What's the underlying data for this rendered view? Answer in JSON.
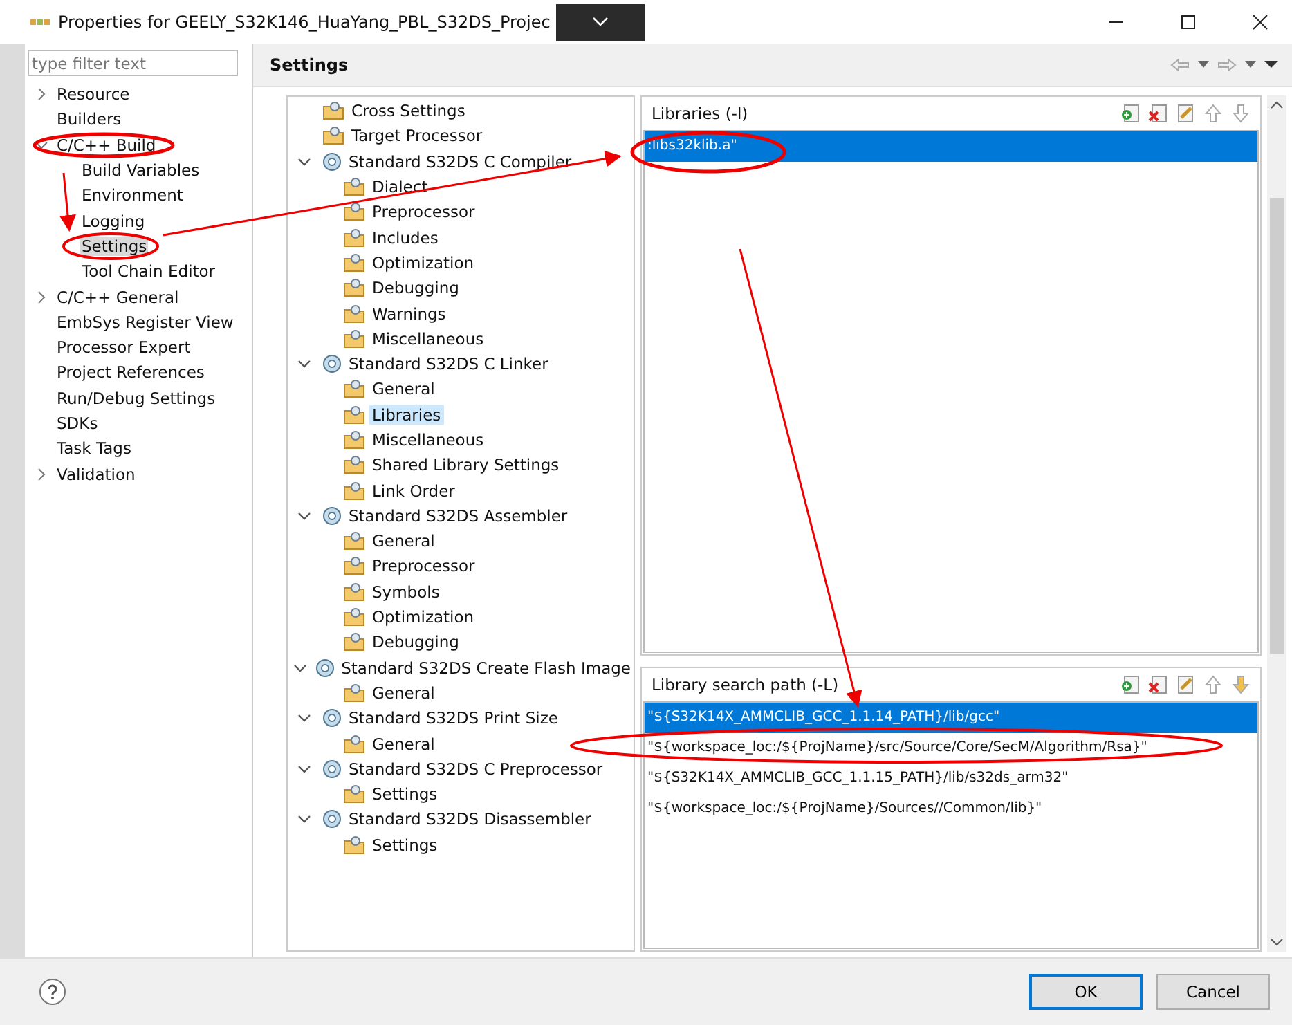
{
  "window": {
    "title": "Properties for GEELY_S32K146_HuaYang_PBL_S32DS_Projec"
  },
  "filter": {
    "placeholder": "type filter text"
  },
  "nav": [
    {
      "label": "Resource",
      "expanded": false,
      "selected": false
    },
    {
      "label": "Builders",
      "selected": false
    },
    {
      "label": "C/C++ Build",
      "expanded": true,
      "selected": false,
      "children": [
        {
          "label": "Build Variables",
          "selected": false
        },
        {
          "label": "Environment",
          "selected": false
        },
        {
          "label": "Logging",
          "selected": false
        },
        {
          "label": "Settings",
          "selected": true
        },
        {
          "label": "Tool Chain Editor",
          "selected": false
        }
      ]
    },
    {
      "label": "C/C++ General",
      "expanded": false,
      "selected": false
    },
    {
      "label": "EmbSys Register View",
      "selected": false
    },
    {
      "label": "Processor Expert",
      "selected": false
    },
    {
      "label": "Project References",
      "selected": false
    },
    {
      "label": "Run/Debug Settings",
      "selected": false
    },
    {
      "label": "SDKs",
      "selected": false
    },
    {
      "label": "Task Tags",
      "selected": false
    },
    {
      "label": "Validation",
      "expanded": false,
      "selected": false
    }
  ],
  "page_title": "Settings",
  "tools": [
    {
      "label": "Cross Settings",
      "kind": "option",
      "selected": false
    },
    {
      "label": "Target Processor",
      "kind": "option",
      "selected": false
    },
    {
      "label": "Standard S32DS C Compiler",
      "kind": "tool",
      "expanded": true,
      "selected": false,
      "children": [
        {
          "label": "Dialect",
          "kind": "option",
          "selected": false
        },
        {
          "label": "Preprocessor",
          "kind": "option",
          "selected": false
        },
        {
          "label": "Includes",
          "kind": "option",
          "selected": false
        },
        {
          "label": "Optimization",
          "kind": "option",
          "selected": false
        },
        {
          "label": "Debugging",
          "kind": "option",
          "selected": false
        },
        {
          "label": "Warnings",
          "kind": "option",
          "selected": false
        },
        {
          "label": "Miscellaneous",
          "kind": "option",
          "selected": false
        }
      ]
    },
    {
      "label": "Standard S32DS C Linker",
      "kind": "tool",
      "expanded": true,
      "selected": false,
      "children": [
        {
          "label": "General",
          "kind": "option",
          "selected": false
        },
        {
          "label": "Libraries",
          "kind": "option",
          "selected": true
        },
        {
          "label": "Miscellaneous",
          "kind": "option",
          "selected": false
        },
        {
          "label": "Shared Library Settings",
          "kind": "option",
          "selected": false
        },
        {
          "label": "Link Order",
          "kind": "option",
          "selected": false
        }
      ]
    },
    {
      "label": "Standard S32DS Assembler",
      "kind": "tool",
      "expanded": true,
      "selected": false,
      "children": [
        {
          "label": "General",
          "kind": "option",
          "selected": false
        },
        {
          "label": "Preprocessor",
          "kind": "option",
          "selected": false
        },
        {
          "label": "Symbols",
          "kind": "option",
          "selected": false
        },
        {
          "label": "Optimization",
          "kind": "option",
          "selected": false
        },
        {
          "label": "Debugging",
          "kind": "option",
          "selected": false
        }
      ]
    },
    {
      "label": "Standard S32DS Create Flash Image",
      "kind": "tool",
      "expanded": true,
      "selected": false,
      "children": [
        {
          "label": "General",
          "kind": "option",
          "selected": false
        }
      ]
    },
    {
      "label": "Standard S32DS Print Size",
      "kind": "tool",
      "expanded": true,
      "selected": false,
      "children": [
        {
          "label": "General",
          "kind": "option",
          "selected": false
        }
      ]
    },
    {
      "label": "Standard S32DS C Preprocessor",
      "kind": "tool",
      "expanded": true,
      "selected": false,
      "children": [
        {
          "label": "Settings",
          "kind": "option",
          "selected": false
        }
      ]
    },
    {
      "label": "Standard S32DS Disassembler",
      "kind": "tool",
      "expanded": true,
      "selected": false,
      "children": [
        {
          "label": "Settings",
          "kind": "option",
          "selected": false
        }
      ]
    }
  ],
  "lists": [
    {
      "title": "Libraries (-l)",
      "items": [
        {
          "text": ":libs32klib.a\"",
          "selected": true
        }
      ]
    },
    {
      "title": "Library search path (-L)",
      "items": [
        {
          "text": "\"${S32K14X_AMMCLIB_GCC_1.1.14_PATH}/lib/gcc\"",
          "selected": true
        },
        {
          "text": "\"${workspace_loc:/${ProjName}/src/Source/Core/SecM/Algorithm/Rsa}\"",
          "selected": false
        },
        {
          "text": "\"${S32K14X_AMMCLIB_GCC_1.1.15_PATH}/lib/s32ds_arm32\"",
          "selected": false
        },
        {
          "text": "\"${workspace_loc:/${ProjName}/Sources//Common/lib}\"",
          "selected": false
        }
      ]
    }
  ],
  "buttons": [
    {
      "label": "OK",
      "kind": "default"
    },
    {
      "label": "Cancel",
      "kind": "normal"
    }
  ]
}
